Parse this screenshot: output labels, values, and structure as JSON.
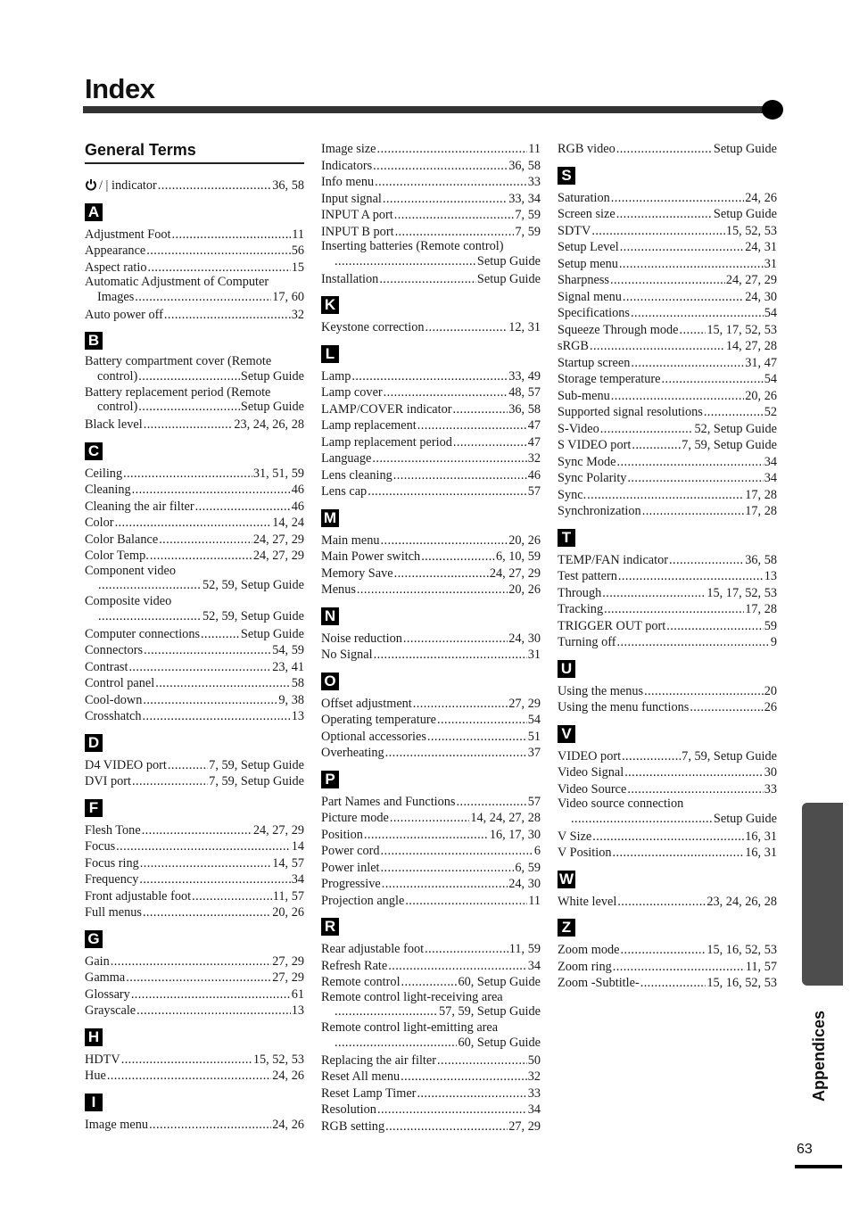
{
  "page": {
    "title": "Index",
    "section_heading": "General Terms",
    "side_tab_label": "Appendices",
    "page_number": "63"
  },
  "columns": [
    {
      "groups": [
        {
          "letter": "",
          "entries": [
            {
              "icon": "power-icon",
              "term": "/ | indicator",
              "pages": "36, 58"
            }
          ]
        },
        {
          "letter": "A",
          "entries": [
            {
              "term": "Adjustment Foot",
              "pages": "11"
            },
            {
              "term": "Appearance",
              "pages": "56"
            },
            {
              "term": "Aspect ratio",
              "pages": "15"
            },
            {
              "term": "Automatic Adjustment of Computer",
              "cont": "Images",
              "pages": "17, 60"
            },
            {
              "term": "Auto power off",
              "pages": "32"
            }
          ]
        },
        {
          "letter": "B",
          "entries": [
            {
              "term": "Battery compartment cover (Remote",
              "cont": "control)",
              "pages": "Setup Guide"
            },
            {
              "term": "Battery replacement period (Remote",
              "cont": "control)",
              "pages": "Setup Guide"
            },
            {
              "term": "Black level",
              "pages": "23, 24, 26, 28"
            }
          ]
        },
        {
          "letter": "C",
          "entries": [
            {
              "term": "Ceiling",
              "pages": "31, 51, 59"
            },
            {
              "term": "Cleaning",
              "pages": "46"
            },
            {
              "term": "Cleaning the air filter",
              "pages": "46"
            },
            {
              "term": "Color",
              "pages": "14, 24"
            },
            {
              "term": "Color Balance",
              "pages": "24, 27, 29"
            },
            {
              "term": "Color Temp.",
              "pages": "24, 27, 29"
            },
            {
              "term": "Component video",
              "cont": "",
              "pages": "52, 59, Setup Guide"
            },
            {
              "term": "Composite video",
              "cont": "",
              "pages": "52, 59, Setup Guide"
            },
            {
              "term": "Computer connections",
              "pages": "Setup Guide"
            },
            {
              "term": "Connectors",
              "pages": "54, 59"
            },
            {
              "term": "Contrast",
              "pages": "23, 41"
            },
            {
              "term": "Control panel",
              "pages": "58"
            },
            {
              "term": "Cool-down",
              "pages": "9, 38"
            },
            {
              "term": "Crosshatch",
              "pages": "13"
            }
          ]
        },
        {
          "letter": "D",
          "entries": [
            {
              "term": "D4 VIDEO port",
              "pages": "7, 59, Setup Guide"
            },
            {
              "term": "DVI port",
              "pages": "7, 59, Setup Guide"
            }
          ]
        },
        {
          "letter": "F",
          "entries": [
            {
              "term": "Flesh Tone",
              "pages": "24, 27, 29"
            },
            {
              "term": "Focus",
              "pages": "14"
            },
            {
              "term": "Focus ring",
              "pages": "14, 57"
            },
            {
              "term": "Frequency",
              "pages": "34"
            },
            {
              "term": "Front adjustable foot",
              "pages": "11, 57"
            },
            {
              "term": "Full menus",
              "pages": "20, 26"
            }
          ]
        },
        {
          "letter": "G",
          "entries": [
            {
              "term": "Gain",
              "pages": "27, 29"
            },
            {
              "term": "Gamma",
              "pages": "27, 29"
            },
            {
              "term": "Glossary",
              "pages": "61"
            },
            {
              "term": "Grayscale",
              "pages": "13"
            }
          ]
        },
        {
          "letter": "H",
          "entries": [
            {
              "term": "HDTV",
              "pages": "15, 52, 53"
            },
            {
              "term": "Hue",
              "pages": "24, 26"
            }
          ]
        },
        {
          "letter": "I",
          "entries": [
            {
              "term": "Image menu",
              "pages": "24, 26"
            }
          ]
        }
      ]
    },
    {
      "groups": [
        {
          "letter": "",
          "entries": [
            {
              "term": "Image size",
              "pages": "11"
            },
            {
              "term": "Indicators",
              "pages": "36, 58"
            },
            {
              "term": "Info menu",
              "pages": "33"
            },
            {
              "term": "Input signal",
              "pages": "33, 34"
            },
            {
              "term": "INPUT A port",
              "pages": "7, 59"
            },
            {
              "term": "INPUT B port",
              "pages": "7, 59"
            },
            {
              "term": "Inserting batteries (Remote control)",
              "cont": "",
              "pages": "Setup Guide"
            },
            {
              "term": "Installation",
              "pages": "Setup Guide"
            }
          ]
        },
        {
          "letter": "K",
          "entries": [
            {
              "term": "Keystone correction",
              "pages": "12, 31"
            }
          ]
        },
        {
          "letter": "L",
          "entries": [
            {
              "term": "Lamp",
              "pages": "33, 49"
            },
            {
              "term": "Lamp cover",
              "pages": "48, 57"
            },
            {
              "term": "LAMP/COVER indicator",
              "pages": "36, 58"
            },
            {
              "term": "Lamp replacement",
              "pages": "47"
            },
            {
              "term": "Lamp replacement period",
              "pages": "47"
            },
            {
              "term": "Language",
              "pages": "32"
            },
            {
              "term": "Lens cleaning",
              "pages": "46"
            },
            {
              "term": "Lens cap",
              "pages": "57"
            }
          ]
        },
        {
          "letter": "M",
          "entries": [
            {
              "term": "Main menu",
              "pages": "20, 26"
            },
            {
              "term": "Main Power switch",
              "pages": "6, 10, 59"
            },
            {
              "term": "Memory Save",
              "pages": "24, 27, 29"
            },
            {
              "term": "Menus",
              "pages": "20, 26"
            }
          ]
        },
        {
          "letter": "N",
          "entries": [
            {
              "term": "Noise reduction",
              "pages": "24, 30"
            },
            {
              "term": "No Signal",
              "pages": "31"
            }
          ]
        },
        {
          "letter": "O",
          "entries": [
            {
              "term": "Offset adjustment",
              "pages": "27, 29"
            },
            {
              "term": "Operating temperature",
              "pages": "54"
            },
            {
              "term": "Optional accessories",
              "pages": "51"
            },
            {
              "term": "Overheating",
              "pages": "37"
            }
          ]
        },
        {
          "letter": "P",
          "entries": [
            {
              "term": "Part Names and Functions",
              "pages": "57"
            },
            {
              "term": "Picture mode",
              "pages": "14, 24, 27, 28"
            },
            {
              "term": "Position",
              "pages": "16, 17, 30"
            },
            {
              "term": "Power cord",
              "pages": "6"
            },
            {
              "term": "Power inlet",
              "pages": "6, 59"
            },
            {
              "term": "Progressive",
              "pages": "24, 30"
            },
            {
              "term": "Projection angle",
              "pages": "11"
            }
          ]
        },
        {
          "letter": "R",
          "entries": [
            {
              "term": "Rear adjustable foot",
              "pages": "11, 59"
            },
            {
              "term": "Refresh Rate",
              "pages": "34"
            },
            {
              "term": "Remote control",
              "pages": "60, Setup Guide"
            },
            {
              "term": "Remote control light-receiving area",
              "cont": "",
              "pages": "57, 59, Setup Guide"
            },
            {
              "term": "Remote control light-emitting area",
              "cont": "",
              "pages": "60, Setup Guide"
            },
            {
              "term": "Replacing the air filter",
              "pages": "50"
            },
            {
              "term": "Reset All menu",
              "pages": "32"
            },
            {
              "term": "Reset Lamp Timer",
              "pages": "33"
            },
            {
              "term": "Resolution",
              "pages": "34"
            },
            {
              "term": "RGB setting",
              "pages": "27, 29"
            }
          ]
        }
      ]
    },
    {
      "groups": [
        {
          "letter": "",
          "entries": [
            {
              "term": "RGB video",
              "pages": "Setup Guide"
            }
          ]
        },
        {
          "letter": "S",
          "entries": [
            {
              "term": "Saturation",
              "pages": "24, 26"
            },
            {
              "term": "Screen size",
              "pages": "Setup Guide"
            },
            {
              "term": "SDTV",
              "pages": "15, 52, 53"
            },
            {
              "term": "Setup Level",
              "pages": "24, 31"
            },
            {
              "term": "Setup menu",
              "pages": "31"
            },
            {
              "term": "Sharpness",
              "pages": "24, 27, 29"
            },
            {
              "term": "Signal menu",
              "pages": "24, 30"
            },
            {
              "term": "Specifications",
              "pages": "54"
            },
            {
              "term": "Squeeze Through mode",
              "pages": "15, 17, 52, 53"
            },
            {
              "term": "sRGB",
              "pages": "14, 27, 28"
            },
            {
              "term": "Startup screen",
              "pages": "31, 47"
            },
            {
              "term": "Storage temperature",
              "pages": "54"
            },
            {
              "term": "Sub-menu",
              "pages": "20, 26"
            },
            {
              "term": "Supported signal resolutions",
              "pages": "52"
            },
            {
              "term": "S-Video",
              "pages": "52, Setup Guide"
            },
            {
              "term": "S VIDEO port",
              "pages": "7, 59, Setup Guide"
            },
            {
              "term": "Sync Mode",
              "pages": "34"
            },
            {
              "term": "Sync Polarity",
              "pages": "34"
            },
            {
              "term": "Sync.",
              "pages": "17, 28"
            },
            {
              "term": "Synchronization",
              "pages": "17, 28"
            }
          ]
        },
        {
          "letter": "T",
          "entries": [
            {
              "term": "TEMP/FAN indicator",
              "pages": "36, 58"
            },
            {
              "term": "Test pattern",
              "pages": "13"
            },
            {
              "term": "Through",
              "pages": "15, 17, 52, 53"
            },
            {
              "term": "Tracking",
              "pages": "17, 28"
            },
            {
              "term": "TRIGGER OUT port",
              "pages": "59"
            },
            {
              "term": "Turning off",
              "pages": "9"
            }
          ]
        },
        {
          "letter": "U",
          "entries": [
            {
              "term": "Using the menus",
              "pages": "20"
            },
            {
              "term": "Using the menu functions",
              "pages": "26"
            }
          ]
        },
        {
          "letter": "V",
          "entries": [
            {
              "term": "VIDEO port",
              "pages": "7, 59, Setup Guide"
            },
            {
              "term": "Video Signal",
              "pages": "30"
            },
            {
              "term": "Video Source",
              "pages": "33"
            },
            {
              "term": "Video source connection",
              "cont": "",
              "pages": "Setup Guide"
            },
            {
              "term": "V Size",
              "pages": "16, 31"
            },
            {
              "term": "V Position",
              "pages": "16, 31"
            }
          ]
        },
        {
          "letter": "W",
          "entries": [
            {
              "term": "White level",
              "pages": "23, 24, 26, 28"
            }
          ]
        },
        {
          "letter": "Z",
          "entries": [
            {
              "term": "Zoom mode",
              "pages": "15, 16, 52, 53"
            },
            {
              "term": "Zoom ring",
              "pages": "11, 57"
            },
            {
              "term": "Zoom -Subtitle-",
              "pages": "15, 16, 52, 53"
            }
          ]
        }
      ]
    }
  ]
}
